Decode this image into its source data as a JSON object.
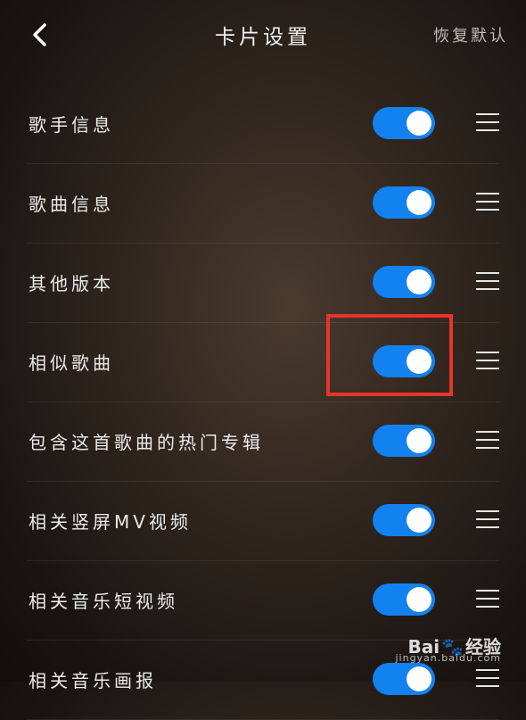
{
  "header": {
    "title": "卡片设置",
    "restore_label": "恢复默认"
  },
  "settings": [
    {
      "label": "歌手信息",
      "enabled": true
    },
    {
      "label": "歌曲信息",
      "enabled": true
    },
    {
      "label": "其他版本",
      "enabled": true
    },
    {
      "label": "相似歌曲",
      "enabled": true
    },
    {
      "label": "包含这首歌曲的热门专辑",
      "enabled": true
    },
    {
      "label": "相关竖屏MV视频",
      "enabled": true
    },
    {
      "label": "相关音乐短视频",
      "enabled": true
    },
    {
      "label": "相关音乐画报",
      "enabled": true
    }
  ],
  "watermark": {
    "brand_left": "Bai",
    "brand_right": "经验",
    "url": "jingyan.baidu.com"
  },
  "colors": {
    "toggle_on": "#1282f0",
    "highlight": "#e8332d"
  }
}
